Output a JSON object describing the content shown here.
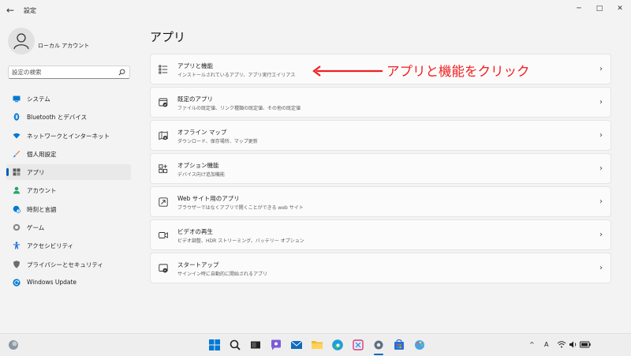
{
  "window": {
    "title": "設定",
    "back": "←",
    "minimize": "─",
    "maximize": "□",
    "close": "✕"
  },
  "user": {
    "name": "ローカル アカウント"
  },
  "search": {
    "placeholder": "設定の検索"
  },
  "nav": [
    {
      "label": "システム",
      "icon": "monitor-icon",
      "color": "#0078d4"
    },
    {
      "label": "Bluetooth とデバイス",
      "icon": "bluetooth-icon",
      "color": "#0078d4"
    },
    {
      "label": "ネットワークとインターネット",
      "icon": "wifi-icon",
      "color": "#0078d4"
    },
    {
      "label": "個人用設定",
      "icon": "brush-icon",
      "color": "#e0883a"
    },
    {
      "label": "アプリ",
      "icon": "apps-icon",
      "color": "#5c5c5c",
      "active": true
    },
    {
      "label": "アカウント",
      "icon": "person-icon",
      "color": "#29a36a"
    },
    {
      "label": "時刻と言語",
      "icon": "globe-clock-icon",
      "color": "#0078d4"
    },
    {
      "label": "ゲーム",
      "icon": "gamepad-icon",
      "color": "#6d6d6d"
    },
    {
      "label": "アクセシビリティ",
      "icon": "accessibility-icon",
      "color": "#1f6fd6"
    },
    {
      "label": "プライバシーとセキュリティ",
      "icon": "shield-icon",
      "color": "#6d6d6d"
    },
    {
      "label": "Windows Update",
      "icon": "update-icon",
      "color": "#0078d4"
    }
  ],
  "page": {
    "title": "アプリ"
  },
  "cards": [
    {
      "title": "アプリと機能",
      "desc": "インストールされているアプリ、アプリ実行エイリアス",
      "icon": "list-icon"
    },
    {
      "title": "既定のアプリ",
      "desc": "ファイルの既定値、リンク種類の既定値、その他の既定値",
      "icon": "default-apps-icon"
    },
    {
      "title": "オフライン マップ",
      "desc": "ダウンロード、保存場所、マップ更新",
      "icon": "map-icon"
    },
    {
      "title": "オプション機能",
      "desc": "デバイス向け追加機能",
      "icon": "optional-features-icon"
    },
    {
      "title": "Web サイト用のアプリ",
      "desc": "ブラウザーではなくアプリで開くことができる web サイト",
      "icon": "open-external-icon"
    },
    {
      "title": "ビデオの再生",
      "desc": "ビデオ調整、HDR ストリーミング、バッテリー オプション",
      "icon": "video-icon"
    },
    {
      "title": "スタートアップ",
      "desc": "サインイン時に自動的に開始されるアプリ",
      "icon": "startup-icon"
    }
  ],
  "chevron": "›",
  "annotation": {
    "text": "アプリと機能をクリック",
    "color": "#f21e1e"
  },
  "taskbar": {
    "apps": [
      "windows-start-icon",
      "search-icon",
      "task-view-icon",
      "chat-icon",
      "mail-icon",
      "file-explorer-icon",
      "edge-icon",
      "snipping-icon",
      "settings-icon",
      "store-icon",
      "paint-icon"
    ],
    "tray_chevron": "^",
    "tray_lang": "A"
  }
}
